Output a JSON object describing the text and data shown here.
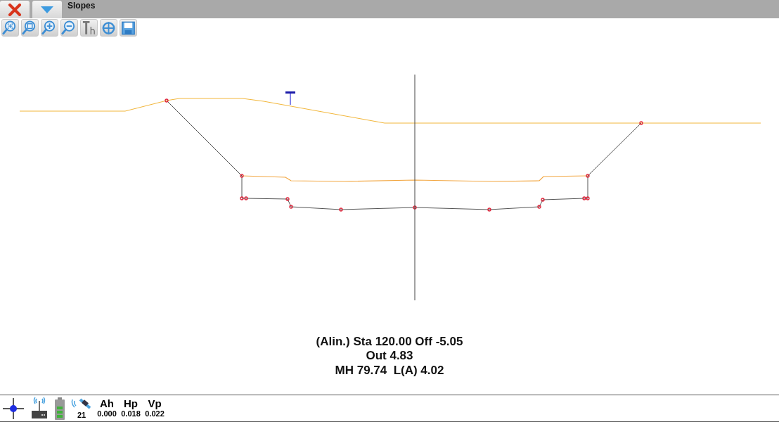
{
  "window": {
    "title": "Slopes"
  },
  "toolbar": {
    "buttons": [
      {
        "kind": "zoom-extents"
      },
      {
        "kind": "zoom-window"
      },
      {
        "kind": "zoom-in"
      },
      {
        "kind": "zoom-out"
      },
      {
        "kind": "height"
      },
      {
        "kind": "center"
      },
      {
        "kind": "save"
      }
    ]
  },
  "info": {
    "lines": [
      "(Alin.) Sta 120.00 Off -5.05",
      "Out 4.83",
      "MH 79.74  L(A) 4.02"
    ]
  },
  "status_bar": {
    "satellites": "21",
    "readouts": [
      {
        "label": "Ah",
        "value": "0.000"
      },
      {
        "label": "Hp",
        "value": "0.018"
      },
      {
        "label": "Vp",
        "value": "0.022"
      }
    ]
  }
}
